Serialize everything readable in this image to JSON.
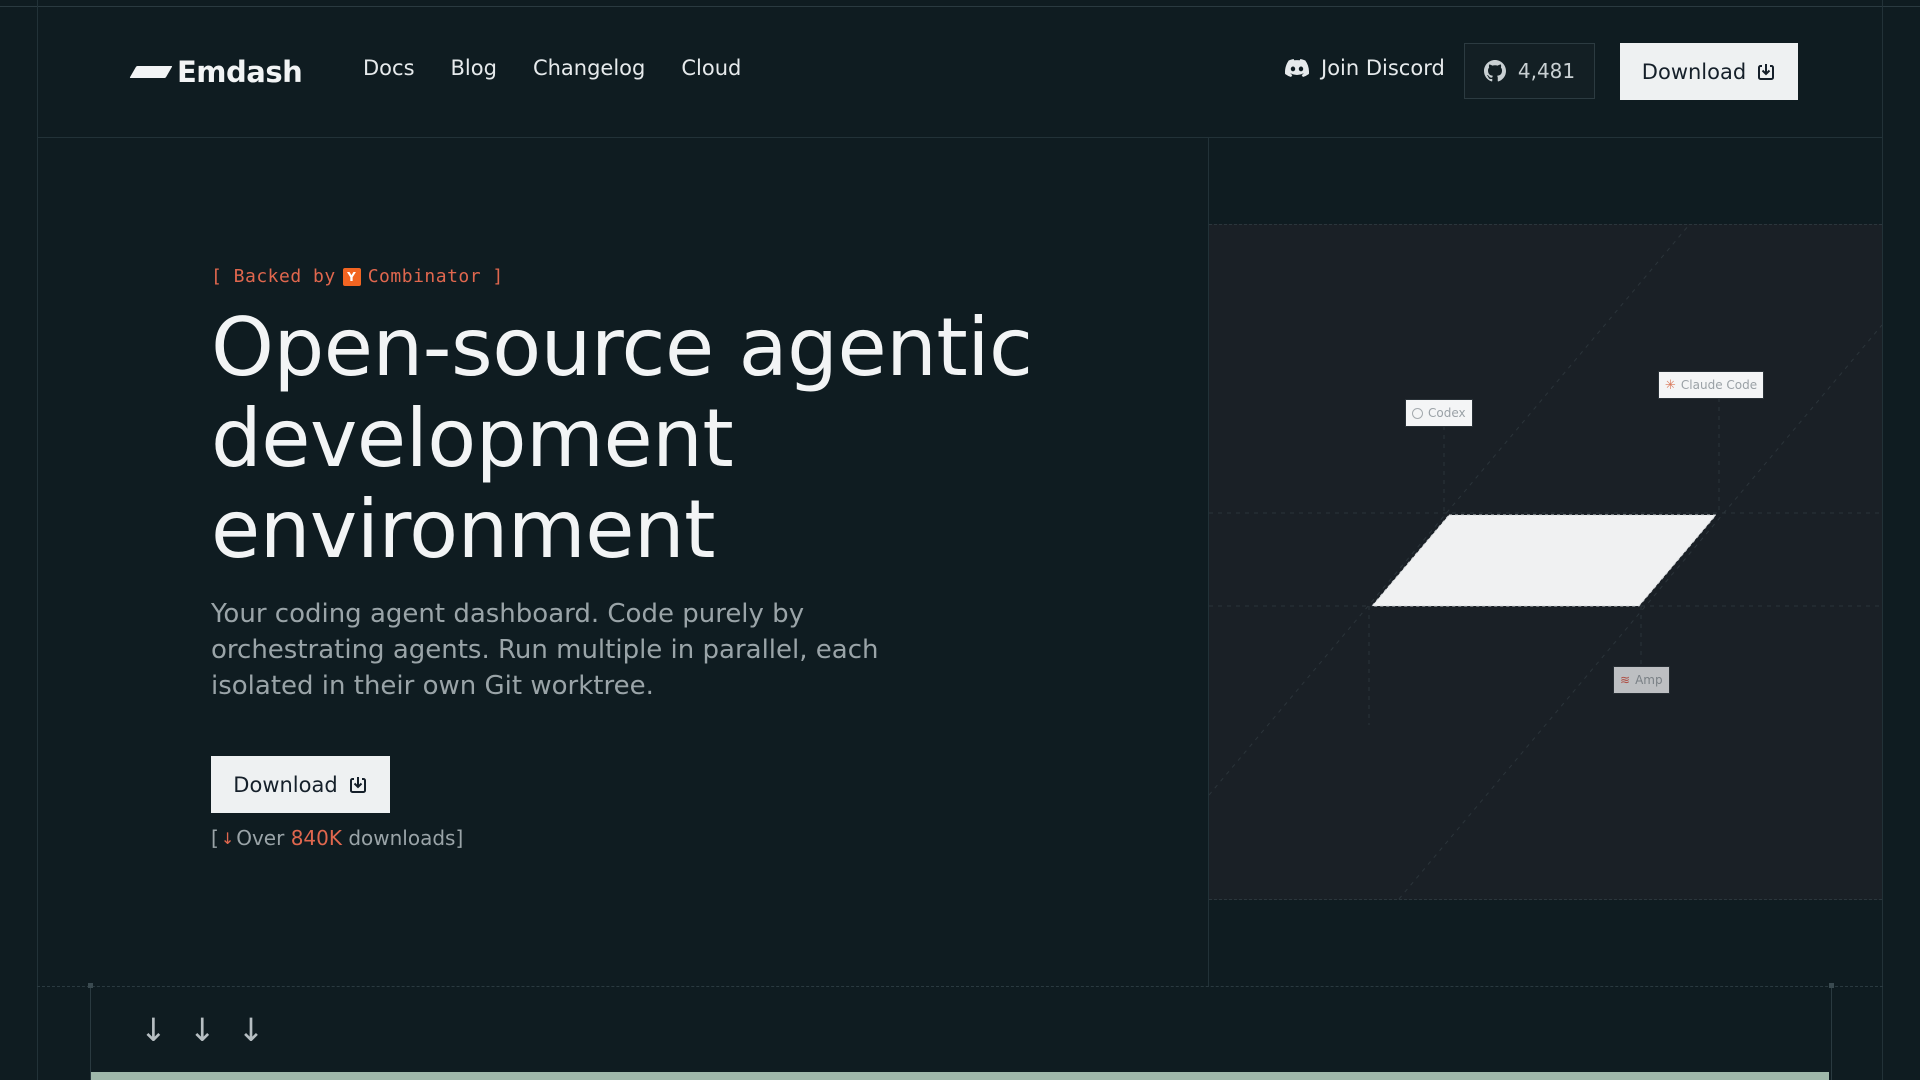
{
  "brand": {
    "name": "Emdash"
  },
  "nav": {
    "links": [
      "Docs",
      "Blog",
      "Changelog",
      "Cloud"
    ],
    "discord_label": "Join Discord",
    "github_stars": "4,481",
    "download_label": "Download"
  },
  "hero": {
    "backed_prefix": "[ Backed by",
    "yc_letter": "Y",
    "backed_suffix": "Combinator ]",
    "headline": [
      "Open-source agentic",
      "development",
      "environment"
    ],
    "subtext": "Your coding agent dashboard. Code purely by orchestrating agents. Run multiple in parallel, each isolated in their own Git worktree.",
    "download_label": "Download",
    "downloads_prefix": "[",
    "downloads_over": "Over",
    "downloads_count": "840K",
    "downloads_suffix": "downloads]"
  },
  "diagram": {
    "agents": [
      "Codex",
      "Claude Code",
      "Amp"
    ]
  },
  "colors": {
    "background": "#0f1c21",
    "accent": "#e0674e",
    "button_bg": "#eef1f2",
    "panel_bg": "#1a2026"
  },
  "icons": [
    "discord-icon",
    "github-icon",
    "download-icon",
    "y-combinator-icon",
    "arrow-down-icon",
    "codex-icon",
    "claude-icon",
    "amp-icon"
  ]
}
